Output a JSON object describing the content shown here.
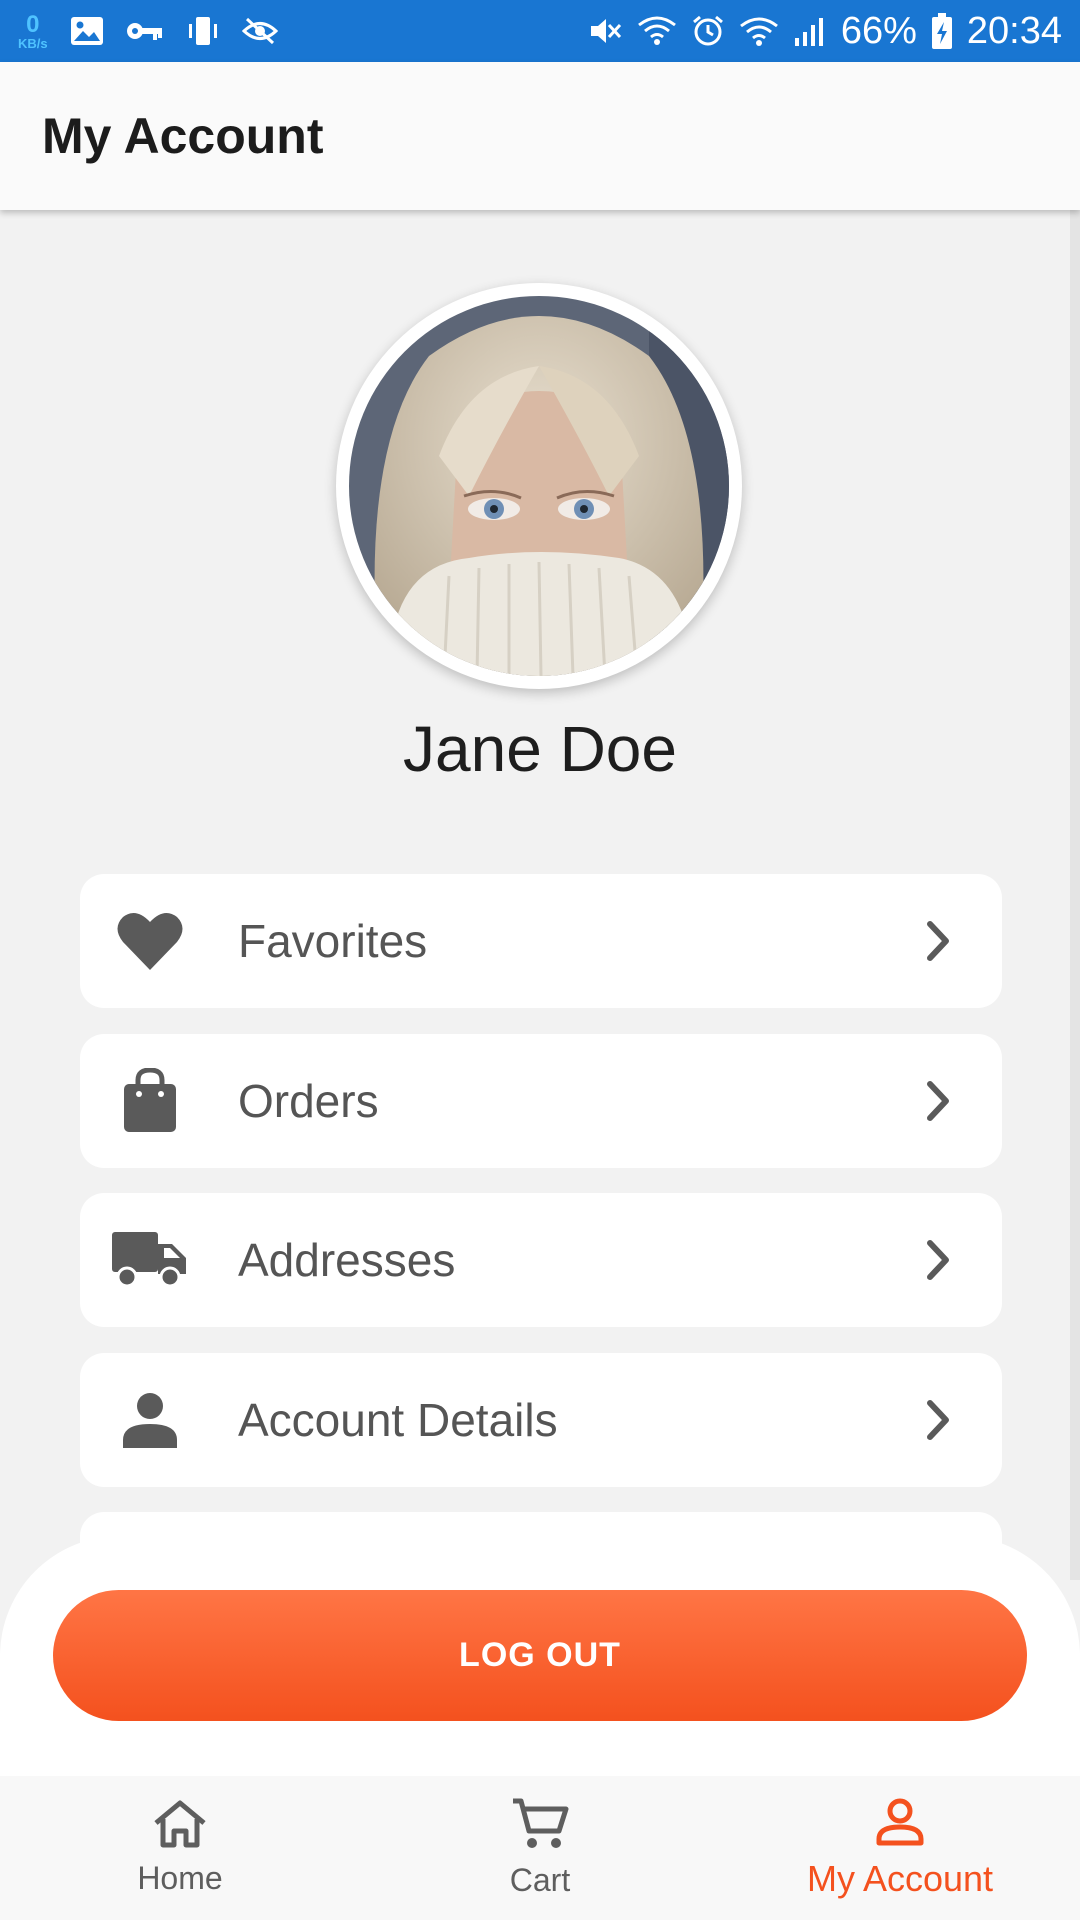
{
  "status_bar": {
    "net_speed_value": "0",
    "net_speed_unit": "KB/s",
    "battery": "66%",
    "time": "20:34"
  },
  "app_bar": {
    "title": "My Account"
  },
  "profile": {
    "name": "Jane Doe"
  },
  "menu": {
    "items": [
      {
        "label": "Favorites",
        "icon": "heart-icon"
      },
      {
        "label": "Orders",
        "icon": "shopping-bag-icon"
      },
      {
        "label": "Addresses",
        "icon": "truck-icon"
      },
      {
        "label": "Account Details",
        "icon": "person-icon"
      }
    ]
  },
  "logout": {
    "label": "LOG OUT"
  },
  "bottom_nav": {
    "items": [
      {
        "label": "Home",
        "icon": "home-icon"
      },
      {
        "label": "Cart",
        "icon": "cart-icon"
      },
      {
        "label": "My Account",
        "icon": "account-icon"
      }
    ],
    "active": "My Account"
  },
  "colors": {
    "status_bar": "#1976d2",
    "accent": "#f4511e",
    "icon": "#5a5a5a",
    "background": "#f2f2f2"
  }
}
